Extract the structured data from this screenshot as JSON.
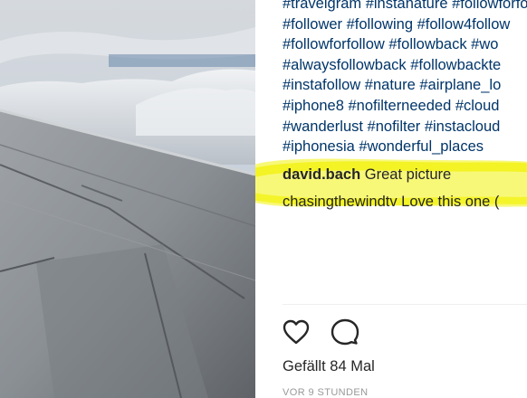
{
  "caption": {
    "hashtag_lines": [
      "#travelgram #instanature #followforfollow",
      "#follower #following #follow4follow",
      "#followforfollow #followback #wo",
      "#alwaysfollowback #followbackte",
      "#instafollow #nature #airplane_lo",
      "#iphone8 #nofilterneeded #cloud",
      "#wanderlust #nofilter #instacloud",
      "#iphonesia #wonderful_places"
    ]
  },
  "comments": [
    {
      "username": "david.bach",
      "text": "Great picture"
    },
    {
      "username": "chasingthewindtv",
      "text": "Love this one ("
    }
  ],
  "actions": {
    "like_icon": "heart-icon",
    "comment_icon": "speech-bubble-icon"
  },
  "likes": {
    "text": "Gefällt 84 Mal"
  },
  "timestamp": {
    "text": "VOR 9 STUNDEN"
  },
  "colors": {
    "hashtag": "#003569",
    "highlight": "#f2f20a",
    "text": "#262626",
    "muted": "#999999"
  }
}
